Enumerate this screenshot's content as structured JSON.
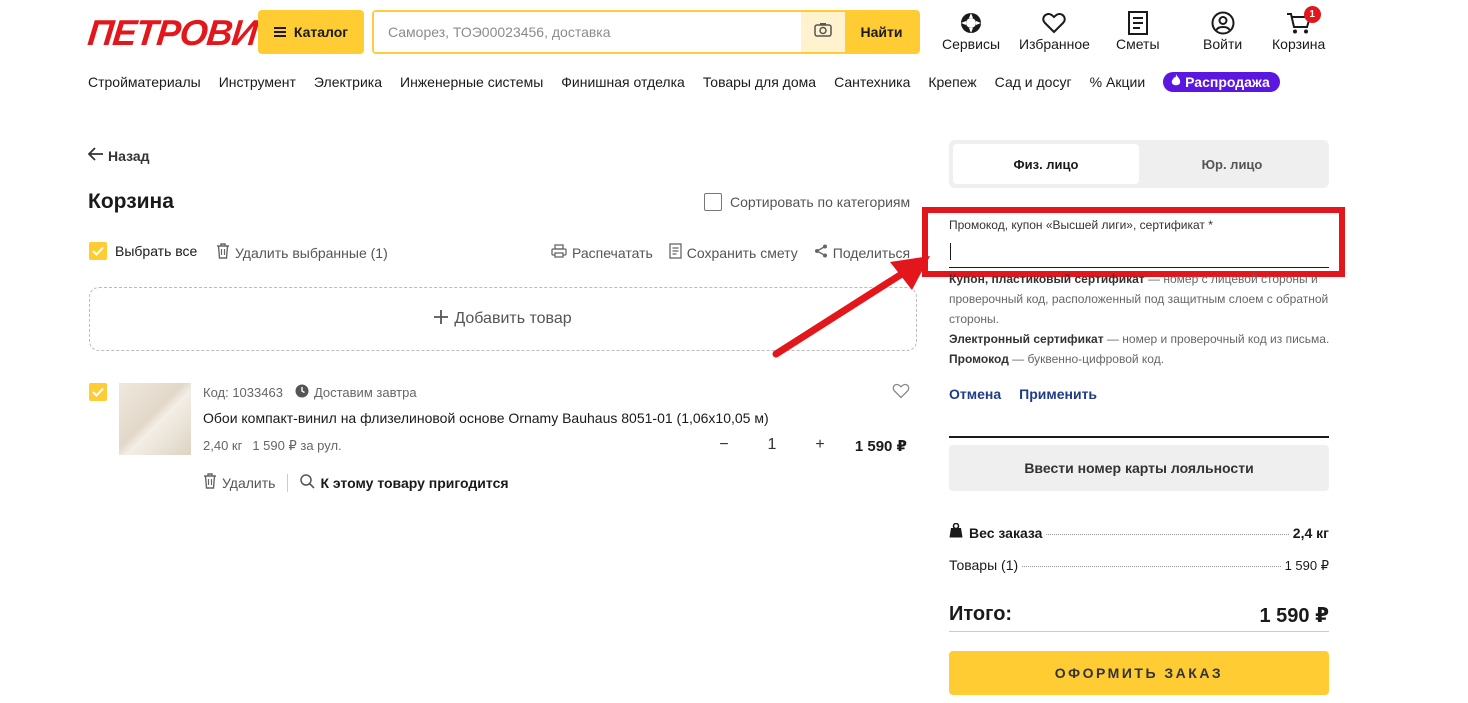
{
  "header": {
    "logo": "ПЕТРОВИЧ",
    "catalog_label": "Каталог",
    "search_placeholder": "Саморез, ТОЭ00023456, доставка",
    "search_button": "Найти",
    "icons": [
      {
        "label": "Сервисы",
        "icon": "services-icon"
      },
      {
        "label": "Избранное",
        "icon": "heart-icon"
      },
      {
        "label": "Сметы",
        "icon": "estimate-icon"
      },
      {
        "label": "Войти",
        "icon": "user-icon"
      },
      {
        "label": "Корзина",
        "icon": "cart-icon",
        "badge": "1"
      }
    ]
  },
  "nav": {
    "items": [
      "Стройматериалы",
      "Инструмент",
      "Электрика",
      "Инженерные системы",
      "Финишная отделка",
      "Товары для дома",
      "Сантехника",
      "Крепеж",
      "Сад и досуг"
    ],
    "promo": "Акции",
    "sale": "Распродажа"
  },
  "cart": {
    "back": "Назад",
    "title": "Корзина",
    "sort_label": "Сортировать по категориям",
    "select_all": "Выбрать все",
    "delete_selected": "Удалить выбранные (1)",
    "print": "Распечатать",
    "save_estimate": "Сохранить смету",
    "share": "Поделиться",
    "add_item": "Добавить товар",
    "item": {
      "code": "Код: 1033463",
      "delivery": "Доставим завтра",
      "name": "Обои компакт-винил на флизелиновой основе Ornamy Bauhaus 8051-01 (1,06х10,05 м)",
      "weight": "2,40 кг",
      "unit_price": "1 590 ₽ за рул.",
      "quantity": "1",
      "price": "1 590 ₽",
      "delete": "Удалить",
      "related": "К этому товару пригодится"
    }
  },
  "summary": {
    "tab_person": "Физ. лицо",
    "tab_company": "Юр. лицо",
    "promo_label": "Промокод, купон «Высшей лиги», сертификат *",
    "promo_value": "",
    "hint_1_bold": "Купон, пластиковый сертификат",
    "hint_1": " — номер с лицевой стороны и проверочный код, расположенный под защитным слоем с обратной стороны.",
    "hint_2_bold": "Электронный сертификат",
    "hint_2": " — номер и проверочный код из письма.",
    "hint_3_bold": "Промокод",
    "hint_3": " — буквенно-цифровой код.",
    "cancel": "Отмена",
    "apply": "Применить",
    "loyalty": "Ввести номер карты лояльности",
    "weight_label": "Вес заказа",
    "weight_value": "2,4 кг",
    "goods_label": "Товары (1)",
    "goods_value": "1 590 ₽",
    "total_label": "Итого:",
    "total_value": "1 590 ₽",
    "checkout": "ОФОРМИТЬ ЗАКАЗ"
  },
  "colors": {
    "accent": "#ffcc33",
    "brand_red": "#e3171b",
    "sale": "#5b16e0",
    "link": "#1f3b8a"
  }
}
